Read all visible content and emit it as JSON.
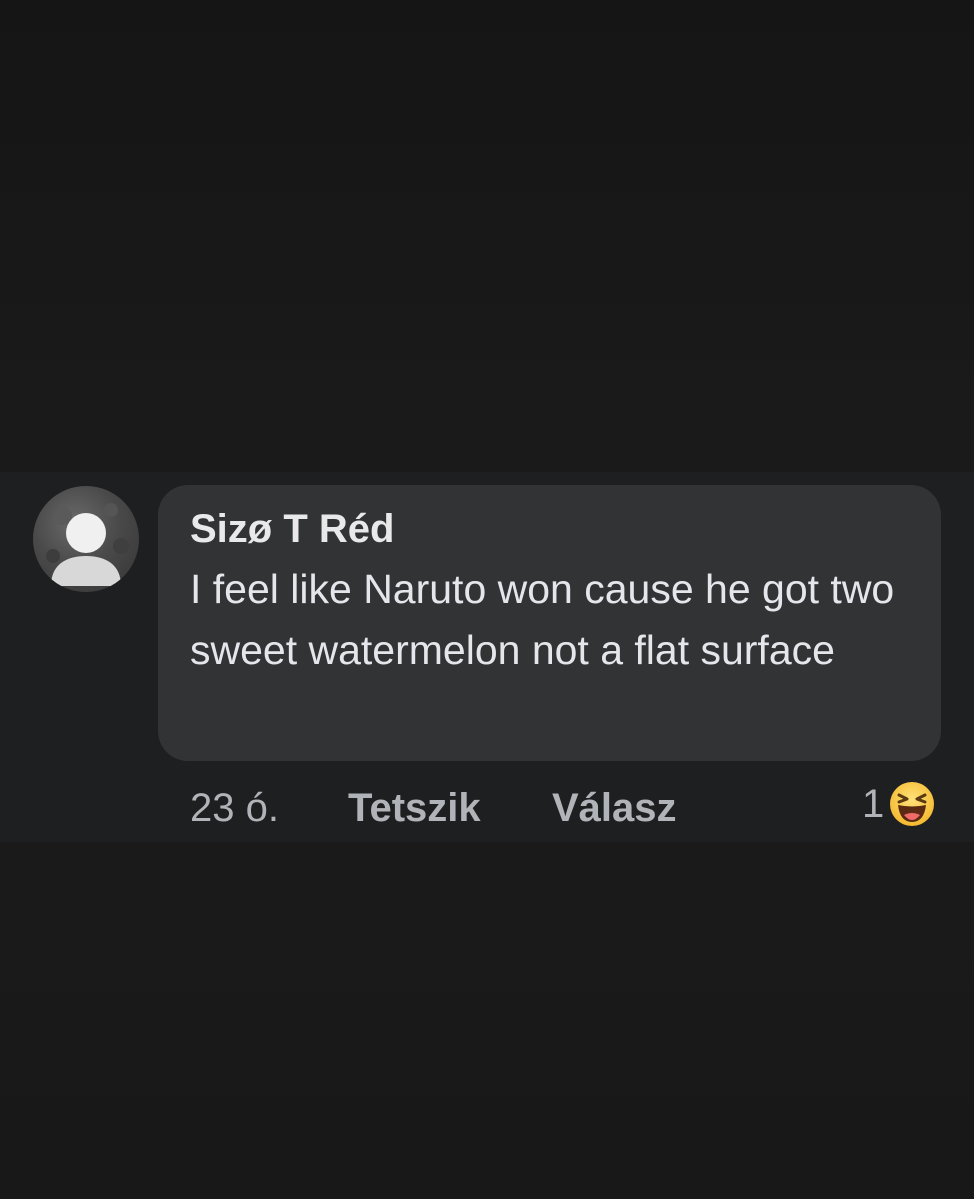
{
  "comment": {
    "author": "Sizø T Réd",
    "text": "I feel like Naruto won cause he got two sweet watermelon not a flat surface",
    "avatar_icon": "default-profile-icon"
  },
  "meta": {
    "time": "23 ó.",
    "like_label": "Tetszik",
    "reply_label": "Válasz",
    "reaction_count": "1",
    "reaction_icon": "haha-emoji-icon"
  },
  "colors": {
    "background": "#1a1a1a",
    "bubble": "#323334",
    "text_primary": "#e4e6eb",
    "text_secondary": "#b0b3b8",
    "emoji_yellow": "#f7c64a"
  }
}
